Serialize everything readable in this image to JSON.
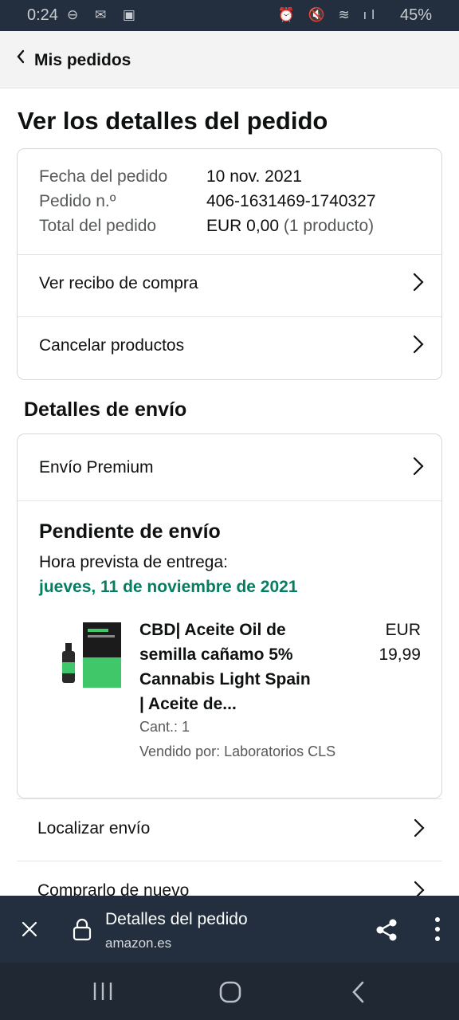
{
  "status_bar": {
    "time": "0:24",
    "left_icons": "⊖ ✉ ▣",
    "right_icons": "⏰ 🔇 ≋ ıl",
    "battery": "45%"
  },
  "nav": {
    "back_label": "Mis pedidos"
  },
  "page_title": "Ver los detalles del pedido",
  "order": {
    "date_label": "Fecha del pedido",
    "date_value": "10 nov. 2021",
    "number_label": "Pedido n.º",
    "number_value": "406-1631469-1740327",
    "total_label": "Total del pedido",
    "total_value": "EUR 0,00",
    "total_items": "(1 producto)",
    "receipt_link": "Ver recibo de compra",
    "cancel_link": "Cancelar productos"
  },
  "shipping": {
    "section_title": "Detalles de envío",
    "method": "Envío Premium",
    "status": "Pendiente de envío",
    "eta_label": "Hora prevista de entrega:",
    "eta_date": "jueves, 11 de noviembre de 2021",
    "product": {
      "title_line1": "CBD| Aceite Oil de",
      "title_line2": "semilla cañamo 5%",
      "title_line3": "Cannabis Light Spain",
      "title_line4": "| Aceite de...",
      "price_currency": "EUR",
      "price_value": "19,99",
      "quantity": "Cant.: 1",
      "seller": "Vendido por: Laboratorios CLS"
    }
  },
  "actions": {
    "track": "Localizar envío",
    "buy_again": "Comprarlo de nuevo"
  },
  "browser": {
    "title": "Detalles del pedido",
    "url": "amazon.es"
  },
  "colors": {
    "header_dark": "#232f3e",
    "eta_green": "#067d62",
    "border": "#d5d9d9"
  }
}
